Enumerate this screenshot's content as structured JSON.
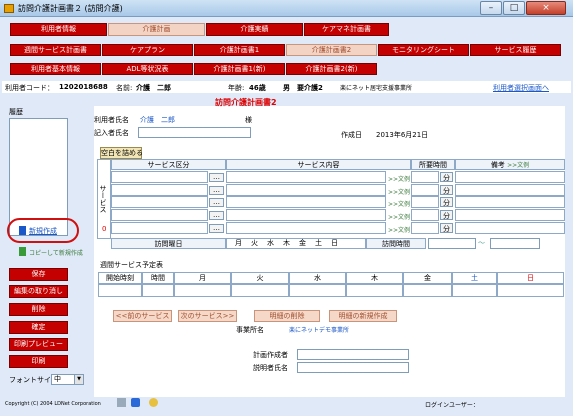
{
  "window": {
    "title": "訪問介護計画書２ (訪問介護)",
    "minimize": "–",
    "maximize": "□",
    "close": "×"
  },
  "top_menu": [
    "利用者情報",
    "介護計画",
    "介護実績",
    "ケアマネ計画書"
  ],
  "menu_row1": [
    "週間サービス計画書",
    "ケアプラン",
    "介護計画書1",
    "介護計画書2",
    "モニタリングシート",
    "サービス履歴"
  ],
  "menu_row2": [
    "利用者基本情報",
    "ADL等状況表",
    "介護計画書1(新)",
    "介護計画書2(新)"
  ],
  "user_bar": {
    "code_label": "利用者コード：",
    "code": "1202018688",
    "name_label": "名前:",
    "name": "介護　二郎",
    "age_label": "年齢:",
    "age": "46歳",
    "sex": "男",
    "care_level": "要介護2",
    "office": "楽にネット居宅支援事業所",
    "back_link": "利用者選択画面へ"
  },
  "sidebar": {
    "history_label": "履歴",
    "new_link": "新規作成",
    "copy_new": "コピーして新規作成",
    "buttons": [
      "保存",
      "編集の取り消し",
      "削除",
      "確定",
      "印刷プレビュー",
      "印刷"
    ],
    "font_label": "フォントサイズ",
    "font_value": "中"
  },
  "form": {
    "page_title": "訪問介護計画書2",
    "user_name_label": "利用者氏名",
    "user_name": "介護　二郎",
    "honorific": "様",
    "writer_label": "記入者氏名",
    "writer_value": "",
    "created_label": "作成日",
    "created_date": "2013年6月21日",
    "fill_button": "空白を詰める",
    "service_section_label": "サービス",
    "service_section_num": "0",
    "col_category": "サービス区分",
    "col_content": "サービス内容",
    "col_time": "所要時間",
    "col_notes": "備考",
    "notes_link": ">>文例",
    "content_link": ">>文例",
    "time_unit": "分",
    "dots": "…",
    "visit_day_label": "訪問曜日",
    "days": "月　火　水　木　金　土　日",
    "visit_time_label": "訪問時間",
    "tilde": "〜",
    "weekly_label": "週間サービス予定表",
    "weekly_cols": [
      "開始時刻",
      "時間",
      "月",
      "火",
      "水",
      "木",
      "金",
      "土",
      "日"
    ],
    "nav_buttons": [
      "<<前のサービス",
      "次のサービス>>",
      "明細の削除",
      "明細の新規作成"
    ],
    "office_label": "事業所名",
    "office_value": "楽にネットデモ事業所",
    "planner_label": "計画作成者",
    "explainer_label": "説明者氏名"
  },
  "status": {
    "copyright": "Copyright (C) 2004 LDNet Corporation",
    "login_label": "ログインユーザー："
  }
}
